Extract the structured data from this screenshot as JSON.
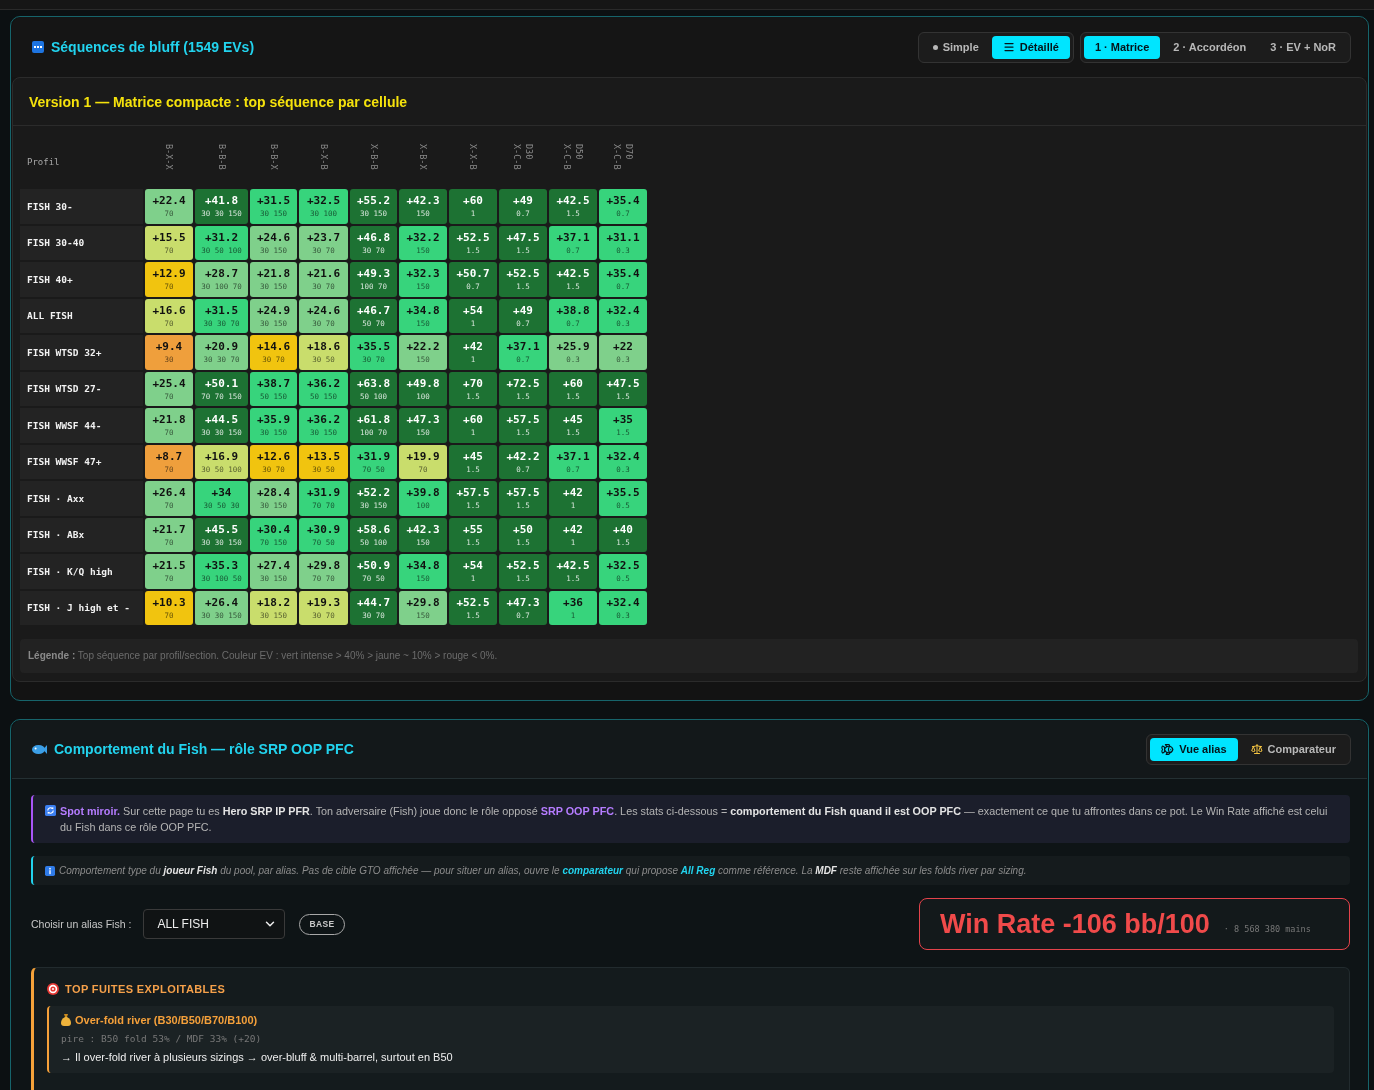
{
  "bluff_panel": {
    "title": "Séquences de bluff (1549 EVs)",
    "view_toggle": [
      {
        "label": "Simple",
        "selected": false
      },
      {
        "label": "Détaillé",
        "selected": true
      }
    ],
    "version_tabs": [
      {
        "label": "1 · Matrice",
        "selected": true
      },
      {
        "label": "2 · Accordéon",
        "selected": false
      },
      {
        "label": "3 · EV + NoR",
        "selected": false
      }
    ],
    "matrix": {
      "title": "Version 1 — Matrice compacte : top séquence par cellule",
      "corner_label": "Profil",
      "columns": [
        {
          "label": "B-X-X"
        },
        {
          "label": "B-B-B"
        },
        {
          "label": "B-B-X"
        },
        {
          "label": "B-X-B"
        },
        {
          "label": "X-B-B"
        },
        {
          "label": "X-B-X"
        },
        {
          "label": "X-X-B"
        },
        {
          "label": "X-C-B",
          "sizing": "D30"
        },
        {
          "label": "X-C-B",
          "sizing": "D50"
        },
        {
          "label": "X-C-B",
          "sizing": "D70"
        }
      ],
      "rows": [
        {
          "profile": "FISH 30-",
          "cells": [
            {
              "ev": "+22.4",
              "sizes": "70",
              "color": "#7fd08b"
            },
            {
              "ev": "+41.8",
              "sizes": "30 30 150",
              "color": "#1d7233"
            },
            {
              "ev": "+31.5",
              "sizes": "30 150",
              "color": "#37d47c"
            },
            {
              "ev": "+32.5",
              "sizes": "30 100",
              "color": "#37d47c"
            },
            {
              "ev": "+55.2",
              "sizes": "30 150",
              "color": "#1d7233"
            },
            {
              "ev": "+42.3",
              "sizes": "150",
              "color": "#1d7233"
            },
            {
              "ev": "+60",
              "sizes": "1",
              "color": "#1d7233"
            },
            {
              "ev": "+49",
              "sizes": "0.7",
              "color": "#1d7233"
            },
            {
              "ev": "+42.5",
              "sizes": "1.5",
              "color": "#1d7233"
            },
            {
              "ev": "+35.4",
              "sizes": "0.7",
              "color": "#37d47c"
            }
          ]
        },
        {
          "profile": "FISH 30-40",
          "cells": [
            {
              "ev": "+15.5",
              "sizes": "70",
              "color": "#c9dd6c"
            },
            {
              "ev": "+31.2",
              "sizes": "30 50 100",
              "color": "#37d47c"
            },
            {
              "ev": "+24.6",
              "sizes": "30 150",
              "color": "#7fd08b"
            },
            {
              "ev": "+23.7",
              "sizes": "30 70",
              "color": "#7fd08b"
            },
            {
              "ev": "+46.8",
              "sizes": "30 70",
              "color": "#1d7233"
            },
            {
              "ev": "+32.2",
              "sizes": "150",
              "color": "#37d47c"
            },
            {
              "ev": "+52.5",
              "sizes": "1.5",
              "color": "#1d7233"
            },
            {
              "ev": "+47.5",
              "sizes": "1.5",
              "color": "#1d7233"
            },
            {
              "ev": "+37.1",
              "sizes": "0.7",
              "color": "#37d47c"
            },
            {
              "ev": "+31.1",
              "sizes": "0.3",
              "color": "#37d47c"
            }
          ]
        },
        {
          "profile": "FISH 40+",
          "cells": [
            {
              "ev": "+12.9",
              "sizes": "70",
              "color": "#f1c40f"
            },
            {
              "ev": "+28.7",
              "sizes": "30 100 70",
              "color": "#7fd08b"
            },
            {
              "ev": "+21.8",
              "sizes": "30 150",
              "color": "#7fd08b"
            },
            {
              "ev": "+21.6",
              "sizes": "30 70",
              "color": "#7fd08b"
            },
            {
              "ev": "+49.3",
              "sizes": "100 70",
              "color": "#1d7233"
            },
            {
              "ev": "+32.3",
              "sizes": "150",
              "color": "#37d47c"
            },
            {
              "ev": "+50.7",
              "sizes": "0.7",
              "color": "#1d7233"
            },
            {
              "ev": "+52.5",
              "sizes": "1.5",
              "color": "#1d7233"
            },
            {
              "ev": "+42.5",
              "sizes": "1.5",
              "color": "#1d7233"
            },
            {
              "ev": "+35.4",
              "sizes": "0.7",
              "color": "#37d47c"
            }
          ]
        },
        {
          "profile": "ALL FISH",
          "cells": [
            {
              "ev": "+16.6",
              "sizes": "70",
              "color": "#c9dd6c"
            },
            {
              "ev": "+31.5",
              "sizes": "30 30 70",
              "color": "#37d47c"
            },
            {
              "ev": "+24.9",
              "sizes": "30 150",
              "color": "#7fd08b"
            },
            {
              "ev": "+24.6",
              "sizes": "30 70",
              "color": "#7fd08b"
            },
            {
              "ev": "+46.7",
              "sizes": "50 70",
              "color": "#1d7233"
            },
            {
              "ev": "+34.8",
              "sizes": "150",
              "color": "#37d47c"
            },
            {
              "ev": "+54",
              "sizes": "1",
              "color": "#1d7233"
            },
            {
              "ev": "+49",
              "sizes": "0.7",
              "color": "#1d7233"
            },
            {
              "ev": "+38.8",
              "sizes": "0.7",
              "color": "#37d47c"
            },
            {
              "ev": "+32.4",
              "sizes": "0.3",
              "color": "#37d47c"
            }
          ]
        },
        {
          "profile": "FISH WTSD 32+",
          "cells": [
            {
              "ev": "+9.4",
              "sizes": "30",
              "color": "#ef9f3c"
            },
            {
              "ev": "+20.9",
              "sizes": "30 30 70",
              "color": "#7fd08b"
            },
            {
              "ev": "+14.6",
              "sizes": "30 70",
              "color": "#f1c40f"
            },
            {
              "ev": "+18.6",
              "sizes": "30 50",
              "color": "#c9dd6c"
            },
            {
              "ev": "+35.5",
              "sizes": "30 70",
              "color": "#37d47c"
            },
            {
              "ev": "+22.2",
              "sizes": "150",
              "color": "#7fd08b"
            },
            {
              "ev": "+42",
              "sizes": "1",
              "color": "#1d7233"
            },
            {
              "ev": "+37.1",
              "sizes": "0.7",
              "color": "#37d47c"
            },
            {
              "ev": "+25.9",
              "sizes": "0.3",
              "color": "#7fd08b"
            },
            {
              "ev": "+22",
              "sizes": "0.3",
              "color": "#7fd08b"
            }
          ]
        },
        {
          "profile": "FISH WTSD 27-",
          "cells": [
            {
              "ev": "+25.4",
              "sizes": "70",
              "color": "#7fd08b"
            },
            {
              "ev": "+50.1",
              "sizes": "70 70 150",
              "color": "#1d7233"
            },
            {
              "ev": "+38.7",
              "sizes": "50 150",
              "color": "#37d47c"
            },
            {
              "ev": "+36.2",
              "sizes": "50 150",
              "color": "#37d47c"
            },
            {
              "ev": "+63.8",
              "sizes": "50 100",
              "color": "#1d7233"
            },
            {
              "ev": "+49.8",
              "sizes": "100",
              "color": "#1d7233"
            },
            {
              "ev": "+70",
              "sizes": "1.5",
              "color": "#1d7233"
            },
            {
              "ev": "+72.5",
              "sizes": "1.5",
              "color": "#1d7233"
            },
            {
              "ev": "+60",
              "sizes": "1.5",
              "color": "#1d7233"
            },
            {
              "ev": "+47.5",
              "sizes": "1.5",
              "color": "#1d7233"
            }
          ]
        },
        {
          "profile": "FISH WWSF 44-",
          "cells": [
            {
              "ev": "+21.8",
              "sizes": "70",
              "color": "#7fd08b"
            },
            {
              "ev": "+44.5",
              "sizes": "30 30 150",
              "color": "#1d7233"
            },
            {
              "ev": "+35.9",
              "sizes": "30 150",
              "color": "#37d47c"
            },
            {
              "ev": "+36.2",
              "sizes": "30 150",
              "color": "#37d47c"
            },
            {
              "ev": "+61.8",
              "sizes": "100 70",
              "color": "#1d7233"
            },
            {
              "ev": "+47.3",
              "sizes": "150",
              "color": "#1d7233"
            },
            {
              "ev": "+60",
              "sizes": "1",
              "color": "#1d7233"
            },
            {
              "ev": "+57.5",
              "sizes": "1.5",
              "color": "#1d7233"
            },
            {
              "ev": "+45",
              "sizes": "1.5",
              "color": "#1d7233"
            },
            {
              "ev": "+35",
              "sizes": "1.5",
              "color": "#37d47c"
            }
          ]
        },
        {
          "profile": "FISH WWSF 47+",
          "cells": [
            {
              "ev": "+8.7",
              "sizes": "70",
              "color": "#ef9f3c"
            },
            {
              "ev": "+16.9",
              "sizes": "30 50 100",
              "color": "#c9dd6c"
            },
            {
              "ev": "+12.6",
              "sizes": "30 70",
              "color": "#f1c40f"
            },
            {
              "ev": "+13.5",
              "sizes": "30 50",
              "color": "#f1c40f"
            },
            {
              "ev": "+31.9",
              "sizes": "70 50",
              "color": "#37d47c"
            },
            {
              "ev": "+19.9",
              "sizes": "70",
              "color": "#c9dd6c"
            },
            {
              "ev": "+45",
              "sizes": "1.5",
              "color": "#1d7233"
            },
            {
              "ev": "+42.2",
              "sizes": "0.7",
              "color": "#1d7233"
            },
            {
              "ev": "+37.1",
              "sizes": "0.7",
              "color": "#37d47c"
            },
            {
              "ev": "+32.4",
              "sizes": "0.3",
              "color": "#37d47c"
            }
          ]
        },
        {
          "profile": "FISH · Axx",
          "cells": [
            {
              "ev": "+26.4",
              "sizes": "70",
              "color": "#7fd08b"
            },
            {
              "ev": "+34",
              "sizes": "30 50 30",
              "color": "#37d47c"
            },
            {
              "ev": "+28.4",
              "sizes": "30 150",
              "color": "#7fd08b"
            },
            {
              "ev": "+31.9",
              "sizes": "70 70",
              "color": "#37d47c"
            },
            {
              "ev": "+52.2",
              "sizes": "30 150",
              "color": "#1d7233"
            },
            {
              "ev": "+39.8",
              "sizes": "100",
              "color": "#37d47c"
            },
            {
              "ev": "+57.5",
              "sizes": "1.5",
              "color": "#1d7233"
            },
            {
              "ev": "+57.5",
              "sizes": "1.5",
              "color": "#1d7233"
            },
            {
              "ev": "+42",
              "sizes": "1",
              "color": "#1d7233"
            },
            {
              "ev": "+35.5",
              "sizes": "0.5",
              "color": "#37d47c"
            }
          ]
        },
        {
          "profile": "FISH · ABx",
          "cells": [
            {
              "ev": "+21.7",
              "sizes": "70",
              "color": "#7fd08b"
            },
            {
              "ev": "+45.5",
              "sizes": "30 30 150",
              "color": "#1d7233"
            },
            {
              "ev": "+30.4",
              "sizes": "70 150",
              "color": "#37d47c"
            },
            {
              "ev": "+30.9",
              "sizes": "70 50",
              "color": "#37d47c"
            },
            {
              "ev": "+58.6",
              "sizes": "50 100",
              "color": "#1d7233"
            },
            {
              "ev": "+42.3",
              "sizes": "150",
              "color": "#1d7233"
            },
            {
              "ev": "+55",
              "sizes": "1.5",
              "color": "#1d7233"
            },
            {
              "ev": "+50",
              "sizes": "1.5",
              "color": "#1d7233"
            },
            {
              "ev": "+42",
              "sizes": "1",
              "color": "#1d7233"
            },
            {
              "ev": "+40",
              "sizes": "1.5",
              "color": "#1d7233"
            }
          ]
        },
        {
          "profile": "FISH · K/Q high",
          "cells": [
            {
              "ev": "+21.5",
              "sizes": "70",
              "color": "#7fd08b"
            },
            {
              "ev": "+35.3",
              "sizes": "30 100 50",
              "color": "#37d47c"
            },
            {
              "ev": "+27.4",
              "sizes": "30 150",
              "color": "#7fd08b"
            },
            {
              "ev": "+29.8",
              "sizes": "70 70",
              "color": "#7fd08b"
            },
            {
              "ev": "+50.9",
              "sizes": "70 50",
              "color": "#1d7233"
            },
            {
              "ev": "+34.8",
              "sizes": "150",
              "color": "#37d47c"
            },
            {
              "ev": "+54",
              "sizes": "1",
              "color": "#1d7233"
            },
            {
              "ev": "+52.5",
              "sizes": "1.5",
              "color": "#1d7233"
            },
            {
              "ev": "+42.5",
              "sizes": "1.5",
              "color": "#1d7233"
            },
            {
              "ev": "+32.5",
              "sizes": "0.5",
              "color": "#37d47c"
            }
          ]
        },
        {
          "profile": "FISH · J high et -",
          "cells": [
            {
              "ev": "+10.3",
              "sizes": "70",
              "color": "#f1c40f"
            },
            {
              "ev": "+26.4",
              "sizes": "30 30 150",
              "color": "#7fd08b"
            },
            {
              "ev": "+18.2",
              "sizes": "30 150",
              "color": "#c9dd6c"
            },
            {
              "ev": "+19.3",
              "sizes": "30 70",
              "color": "#c9dd6c"
            },
            {
              "ev": "+44.7",
              "sizes": "30 70",
              "color": "#1d7233"
            },
            {
              "ev": "+29.8",
              "sizes": "150",
              "color": "#7fd08b"
            },
            {
              "ev": "+52.5",
              "sizes": "1.5",
              "color": "#1d7233"
            },
            {
              "ev": "+47.3",
              "sizes": "0.7",
              "color": "#1d7233"
            },
            {
              "ev": "+36",
              "sizes": "1",
              "color": "#37d47c"
            },
            {
              "ev": "+32.4",
              "sizes": "0.3",
              "color": "#37d47c"
            }
          ]
        }
      ],
      "legend": "**Légende :** Top séquence par profil/section. Couleur EV : vert intense > 40% > jaune ~ 10% > rouge < 0%."
    }
  },
  "fish_panel": {
    "title": "Comportement du Fish — rôle SRP OOP PFC",
    "mode_tabs": [
      {
        "label": "Vue alias",
        "selected": true
      },
      {
        "label": "Comparateur",
        "selected": false
      }
    ],
    "mirror_note": [
      {
        "kind": "accent",
        "text": "Spot miroir."
      },
      {
        "kind": "plain",
        "text": " Sur cette page tu es "
      },
      {
        "kind": "strong",
        "text": "Hero SRP IP PFR"
      },
      {
        "kind": "plain",
        "text": ". Ton adversaire (Fish) joue donc le rôle opposé "
      },
      {
        "kind": "accent",
        "text": "SRP OOP PFC"
      },
      {
        "kind": "plain",
        "text": ". Les stats ci-dessous = "
      },
      {
        "kind": "strong",
        "text": "comportement du Fish quand il est OOP PFC"
      },
      {
        "kind": "plain",
        "text": " — exactement ce que tu affrontes dans ce pot. Le Win Rate affiché est celui du Fish dans ce rôle OOP PFC."
      }
    ],
    "info_note": [
      {
        "kind": "plain",
        "text": "Comportement type du "
      },
      {
        "kind": "strong",
        "text": "joueur Fish"
      },
      {
        "kind": "plain",
        "text": " du pool, par alias. Pas de cible GTO affichée — pour situer un alias, ouvre le "
      },
      {
        "kind": "highlight",
        "text": "comparateur"
      },
      {
        "kind": "plain",
        "text": " qui propose "
      },
      {
        "kind": "highlight",
        "text": "All Reg"
      },
      {
        "kind": "plain",
        "text": " comme référence. La "
      },
      {
        "kind": "strong",
        "text": "MDF"
      },
      {
        "kind": "plain",
        "text": " reste affichée sur les folds river par sizing."
      }
    ],
    "alias_picker": {
      "label": "Choisir un alias Fish :",
      "value": "ALL FISH",
      "badge": "BASE"
    },
    "win_rate": {
      "value": "Win Rate -106 bb/100",
      "hands": "· 8 568 380 mains"
    },
    "leaks": {
      "title": "TOP FUITES EXPLOITABLES",
      "items": [
        {
          "title": "Over-fold river (B30/B50/B70/B100)",
          "detail": "pire : B50 fold 53% / MDF 33% (+20)",
          "advice": "→ Il over-fold river à plusieurs sizings → over-bluff & multi-barrel, surtout en B50"
        }
      ]
    }
  }
}
